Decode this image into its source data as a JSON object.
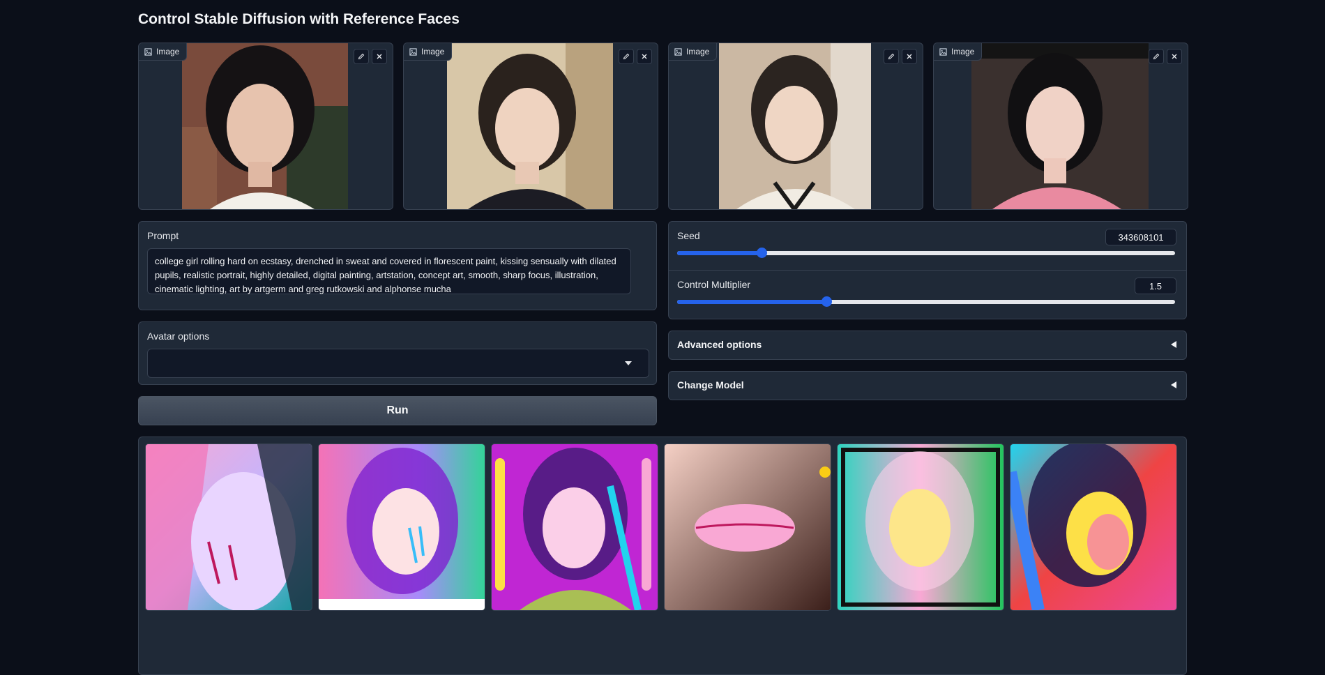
{
  "page": {
    "title": "Control Stable Diffusion with Reference Faces"
  },
  "reference_images": [
    {
      "label": "Image"
    },
    {
      "label": "Image"
    },
    {
      "label": "Image"
    },
    {
      "label": "Image"
    }
  ],
  "prompt": {
    "label": "Prompt",
    "value": "college girl rolling hard on ecstasy, drenched in sweat and covered in florescent paint, kissing sensually with dilated pupils, realistic portrait, highly detailed, digital painting, artstation, concept art, smooth, sharp focus, illustration, cinematic lighting, art by artgerm and greg rutkowski and alphonse mucha"
  },
  "avatar_options": {
    "label": "Avatar options",
    "value": ""
  },
  "run_button": {
    "label": "Run"
  },
  "seed": {
    "label": "Seed",
    "value": "343608101",
    "level": 0.17
  },
  "control_multiplier": {
    "label": "Control Multiplier",
    "value": "1.5",
    "level": 0.3
  },
  "advanced_options": {
    "label": "Advanced options"
  },
  "change_model": {
    "label": "Change Model"
  },
  "icons": {
    "image": "image-icon",
    "edit": "pencil-icon",
    "clear": "close-icon",
    "dropdown": "chevron-down-icon",
    "accordion": "triangle-left-icon"
  },
  "colors": {
    "background": "#0b0f19",
    "panel": "#1f2937",
    "accent": "#2563eb"
  }
}
